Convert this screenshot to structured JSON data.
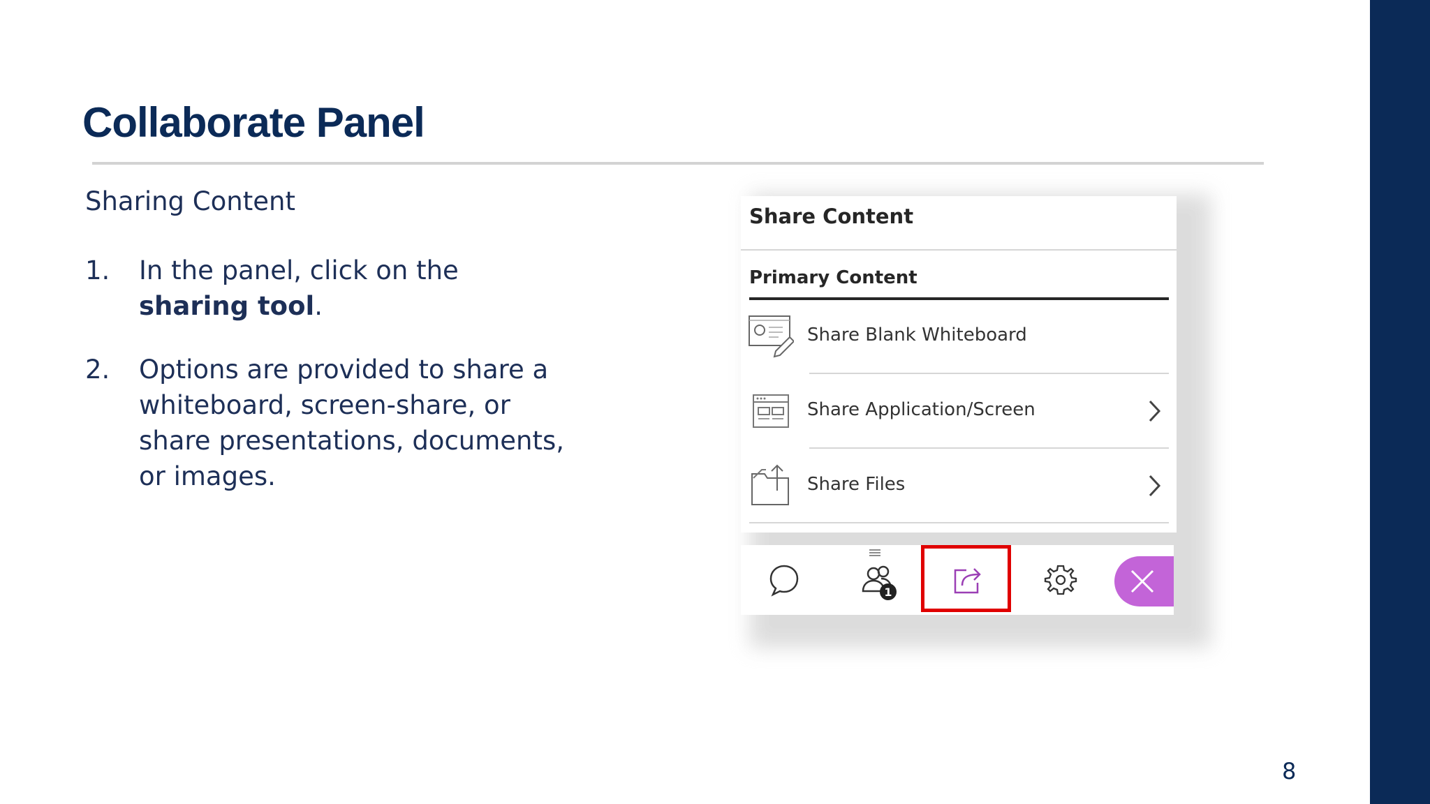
{
  "slide": {
    "title": "Collaborate Panel",
    "subheading": "Sharing Content",
    "page_number": "8"
  },
  "steps": [
    {
      "num": "1.",
      "text_before": "In the panel, click on the ",
      "bold": "sharing tool",
      "text_after": "."
    },
    {
      "num": "2.",
      "text": "Options are provided to share a whiteboard, screen-share, or share presentations, documents, or images."
    }
  ],
  "panel": {
    "title": "Share Content",
    "tab": "Primary Content",
    "items": [
      {
        "label": "Share Blank Whiteboard",
        "icon": "whiteboard-icon",
        "has_chevron": false
      },
      {
        "label": "Share Application/Screen",
        "icon": "screen-share-icon",
        "has_chevron": true
      },
      {
        "label": "Share Files",
        "icon": "share-files-icon",
        "has_chevron": true
      }
    ]
  },
  "toolbar": {
    "buttons": [
      "chat-icon",
      "attendees-icon",
      "share-content-icon",
      "settings-icon",
      "close-icon"
    ],
    "attendee_count": "1"
  },
  "colors": {
    "navy": "#0b2a57",
    "highlight": "#e00000",
    "close_pill": "#c364d8",
    "share_icon": "#9b3fb5"
  }
}
